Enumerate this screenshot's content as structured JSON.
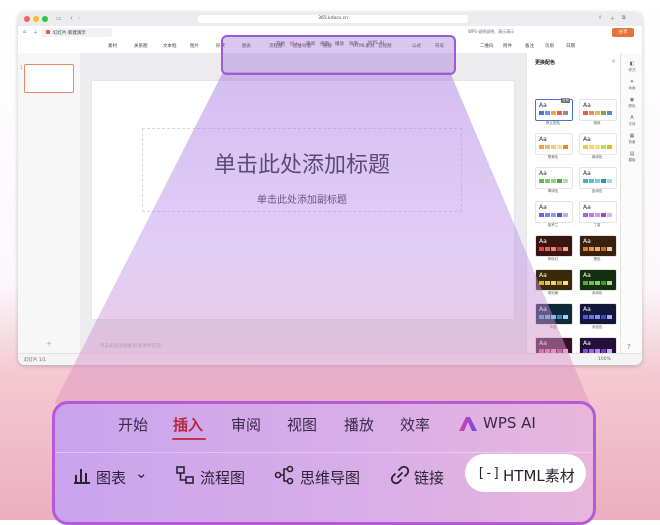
{
  "browser": {
    "url": "365.kdocs.cn",
    "tab_title": "幻灯片·新建演示",
    "tab2_title": "WPS·说明说明、演示演示",
    "share_label": "分享"
  },
  "ribbon_small": {
    "tabs": [
      "开始",
      "插入",
      "审阅",
      "视图",
      "播放",
      "效率",
      "WPS AI"
    ],
    "tools": [
      "素材",
      "关系图",
      "文本框",
      "图片",
      "形状",
      "图表",
      "流程图",
      "思维导图",
      "链接",
      "HTML素材",
      "音视频",
      "公式",
      "符号",
      "二维码",
      "附件",
      "备注",
      "页眉",
      "日期"
    ]
  },
  "slide": {
    "title_placeholder": "单击此处添加标题",
    "subtitle_placeholder": "单击此处添加副标题"
  },
  "editor": {
    "notes_placeholder": "单击此处添加备注(演讲时可见)",
    "slide_counter": "幻灯片 1/1",
    "zoom_level": "100%"
  },
  "theme_panel": {
    "title": "更换配色",
    "current_badge": "当前",
    "swatches": [
      {
        "label": "默认配色",
        "colors": [
          "#4c6fd8",
          "#6e8ff0",
          "#f2a33a",
          "#e85a4f",
          "#8c8c8c"
        ],
        "bg": "#ffffff",
        "aa": "#333333"
      },
      {
        "label": "雅致",
        "colors": [
          "#e45a48",
          "#e88c52",
          "#f0b45a",
          "#7aa05c",
          "#5e8ad0"
        ],
        "bg": "#ffffff",
        "aa": "#333333"
      },
      {
        "label": "橘黄色",
        "colors": [
          "#f2a33a",
          "#f4b858",
          "#f6c978",
          "#f8d89a",
          "#e08a2a"
        ],
        "bg": "#ffffff",
        "aa": "#333333"
      },
      {
        "label": "黄绿色",
        "colors": [
          "#f2c83a",
          "#f4d45c",
          "#f6dd7e",
          "#c4d84a",
          "#e6b82c"
        ],
        "bg": "#ffffff",
        "aa": "#333333"
      },
      {
        "label": "翠绿色",
        "colors": [
          "#5cbf4a",
          "#76cc64",
          "#92d680",
          "#4aa83c",
          "#b2e2a4"
        ],
        "bg": "#ffffff",
        "aa": "#333333"
      },
      {
        "label": "蓝绿色",
        "colors": [
          "#3ab4c8",
          "#54c2d4",
          "#7ad0de",
          "#2a98b0",
          "#9edde8"
        ],
        "bg": "#ffffff",
        "aa": "#333333"
      },
      {
        "label": "紫罗兰",
        "colors": [
          "#5a6ae0",
          "#7484ea",
          "#8e9cf0",
          "#4c58c8",
          "#aab4f4"
        ],
        "bg": "#ffffff",
        "aa": "#333333"
      },
      {
        "label": "丁香",
        "colors": [
          "#b05ad8",
          "#c276e2",
          "#d494ea",
          "#9c48c4",
          "#e2b2f0"
        ],
        "bg": "#ffffff",
        "aa": "#333333"
      },
      {
        "label": "朱砂红",
        "colors": [
          "#d84a3a",
          "#e2684e",
          "#ea8868",
          "#c23a2c",
          "#f0a890"
        ],
        "bg": "#3a1410",
        "aa": "#ffffff"
      },
      {
        "label": "橙色",
        "colors": [
          "#e87a2a",
          "#ee9446",
          "#f2ac68",
          "#d0661c",
          "#f6c492"
        ],
        "bg": "#3a200e",
        "aa": "#ffffff"
      },
      {
        "label": "琥珀黄",
        "colors": [
          "#e8b02a",
          "#eec248",
          "#f2d06a",
          "#d09a1c",
          "#f6de92"
        ],
        "bg": "#3a2a0a",
        "aa": "#ffffff"
      },
      {
        "label": "深绿色",
        "colors": [
          "#4cb03a",
          "#66c054",
          "#84ce72",
          "#3a9a2c",
          "#a6dc98"
        ],
        "bg": "#14300e",
        "aa": "#ffffff"
      },
      {
        "label": "冰蓝",
        "colors": [
          "#3aa8e0",
          "#56b8e8",
          "#78c8ee",
          "#2a90c8",
          "#9cd8f2"
        ],
        "bg": "#0e2838",
        "aa": "#ffffff"
      },
      {
        "label": "深蓝色",
        "colors": [
          "#4a5ae8",
          "#6474ee",
          "#8290f2",
          "#3a48d0",
          "#a4aef6"
        ],
        "bg": "#12163a",
        "aa": "#ffffff"
      },
      {
        "label": "",
        "colors": [
          "#e04a9a",
          "#e86aae",
          "#ee8ac2",
          "#c83a88",
          "#f2aad4"
        ],
        "bg": "#3a0e26",
        "aa": "#ffffff"
      },
      {
        "label": "",
        "colors": [
          "#8a4ae0",
          "#a06aea",
          "#b68af0",
          "#7a3ac8",
          "#ccaaf4"
        ],
        "bg": "#22103a",
        "aa": "#ffffff"
      }
    ]
  },
  "right_sidebar": [
    "样式",
    "动画",
    "颜色",
    "字体",
    "背景",
    "模板"
  ],
  "zoom_view": {
    "tabs": [
      "开始",
      "插入",
      "审阅",
      "视图",
      "播放",
      "效率",
      "WPS AI"
    ],
    "active_tab": "插入",
    "tools": [
      "图表",
      "流程图",
      "思维导图",
      "链接",
      "HTML素材"
    ],
    "chart_dropdown_glyph": "⌄",
    "html_icon_glyph": "[-]"
  },
  "colors": {
    "accent_red": "#c2334a",
    "overlay_purple": "#9d5bd8",
    "wps_ai_gradient": [
      "#e040a0",
      "#6a4cf0"
    ]
  }
}
